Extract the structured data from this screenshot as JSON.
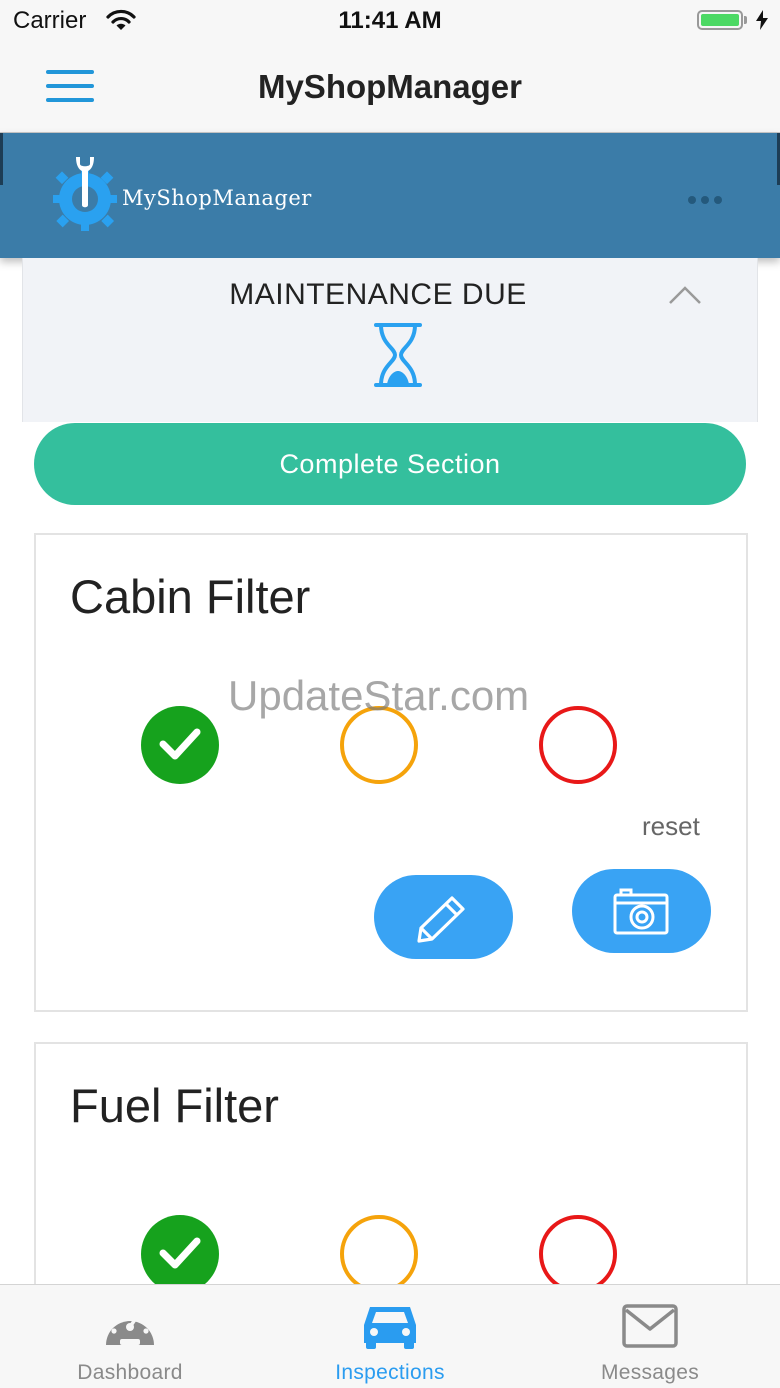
{
  "status_bar": {
    "carrier": "Carrier",
    "time": "11:41 AM",
    "battery_level": 1.0,
    "wifi_icon": "wifi-icon",
    "charging_icon": "bolt-icon"
  },
  "nav": {
    "title": "MyShopManager",
    "menu_icon": "hamburger-menu-icon"
  },
  "brand": {
    "logo_text": "MyShopManager",
    "logo_icon": "gear-wrench-icon",
    "more_icon": "more-dots-icon"
  },
  "section": {
    "title": "MAINTENANCE DUE",
    "icon": "hourglass-icon",
    "collapse_icon": "chevron-up-icon",
    "complete_label": "Complete Section"
  },
  "items": [
    {
      "name": "Cabin Filter",
      "status": "ok",
      "reset_label": "reset",
      "edit_icon": "pencil-icon",
      "camera_icon": "camera-icon"
    },
    {
      "name": "Fuel Filter",
      "status": "ok"
    }
  ],
  "watermark": "UpdateStar.com",
  "tabs": [
    {
      "label": "Dashboard",
      "icon": "speedometer-icon",
      "active": false
    },
    {
      "label": "Inspections",
      "icon": "car-icon",
      "active": true
    },
    {
      "label": "Messages",
      "icon": "envelope-icon",
      "active": false
    }
  ],
  "colors": {
    "brand_blue": "#3b7ca8",
    "nav_accent": "#2196d9",
    "complete_green": "#34bf9d",
    "status_ok": "#16a21d",
    "status_warn": "#f5a30b",
    "status_bad": "#e81818",
    "action_blue": "#39a3f4",
    "tab_inactive": "#8a8a8a"
  }
}
